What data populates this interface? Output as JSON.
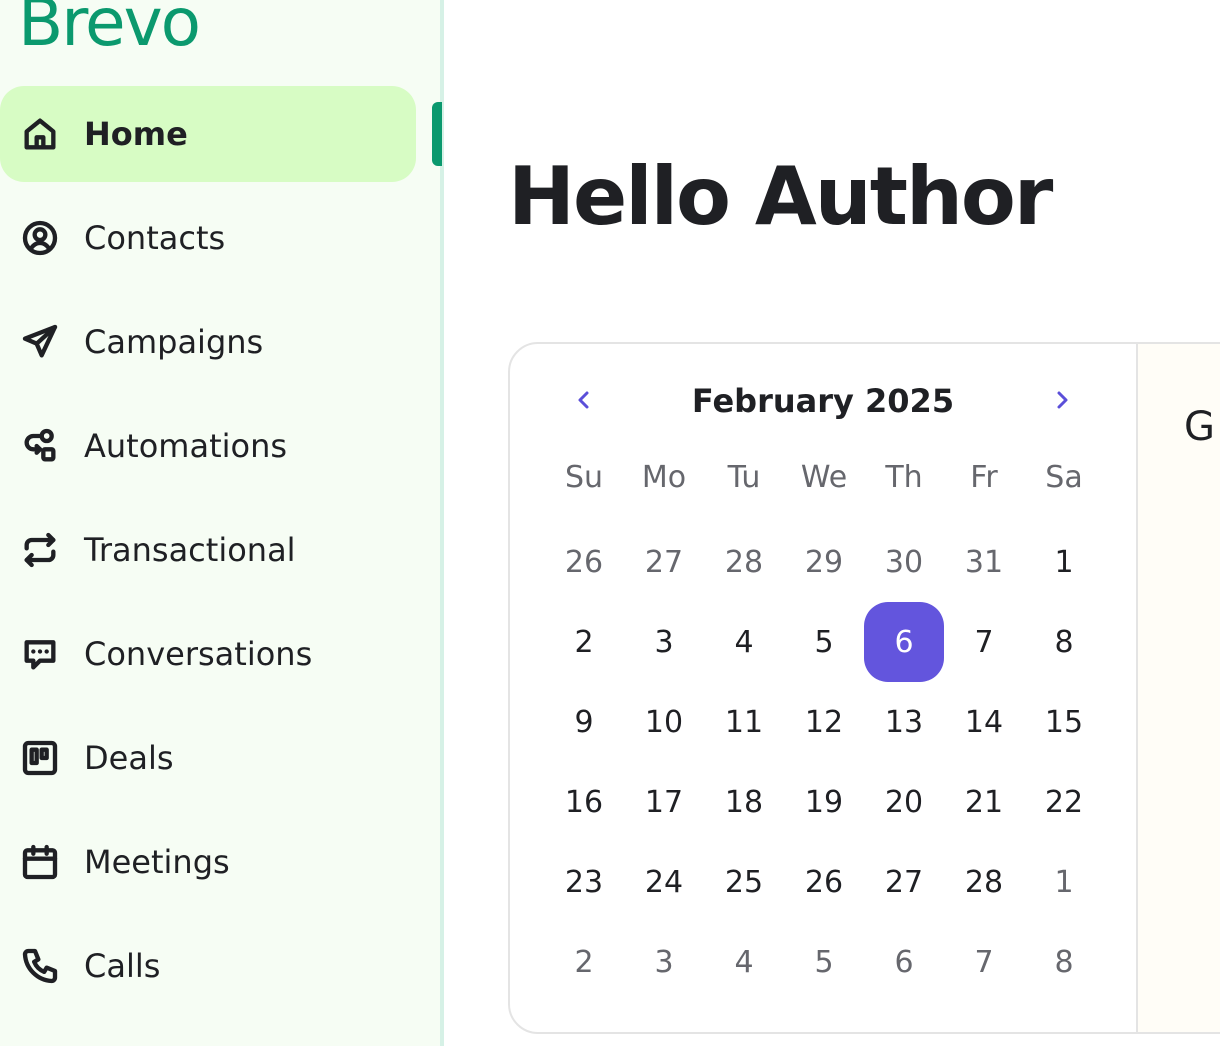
{
  "brand": {
    "logo_text": "Brevo",
    "color": "#0b996e"
  },
  "sidebar": {
    "items": [
      {
        "label": "Home",
        "icon": "home-icon",
        "active": true
      },
      {
        "label": "Contacts",
        "icon": "contacts-icon"
      },
      {
        "label": "Campaigns",
        "icon": "send-icon"
      },
      {
        "label": "Automations",
        "icon": "automations-icon"
      },
      {
        "label": "Transactional",
        "icon": "transactional-icon"
      },
      {
        "label": "Conversations",
        "icon": "chat-icon"
      },
      {
        "label": "Deals",
        "icon": "kanban-icon"
      },
      {
        "label": "Meetings",
        "icon": "calendar-icon"
      },
      {
        "label": "Calls",
        "icon": "phone-icon"
      }
    ]
  },
  "main": {
    "greeting": "Hello Author",
    "right_panel_partial_label": "G"
  },
  "calendar": {
    "month_label": "February 2025",
    "weekdays": [
      "Su",
      "Mo",
      "Tu",
      "We",
      "Th",
      "Fr",
      "Sa"
    ],
    "weeks": [
      [
        "26",
        "27",
        "28",
        "29",
        "30",
        "31",
        "1"
      ],
      [
        "2",
        "3",
        "4",
        "5",
        "6",
        "7",
        "8"
      ],
      [
        "9",
        "10",
        "11",
        "12",
        "13",
        "14",
        "15"
      ],
      [
        "16",
        "17",
        "18",
        "19",
        "20",
        "21",
        "22"
      ],
      [
        "23",
        "24",
        "25",
        "26",
        "27",
        "28",
        "1"
      ],
      [
        "2",
        "3",
        "4",
        "5",
        "6",
        "7",
        "8"
      ]
    ],
    "selected_day": "6",
    "accent_color": "#6355dd"
  }
}
